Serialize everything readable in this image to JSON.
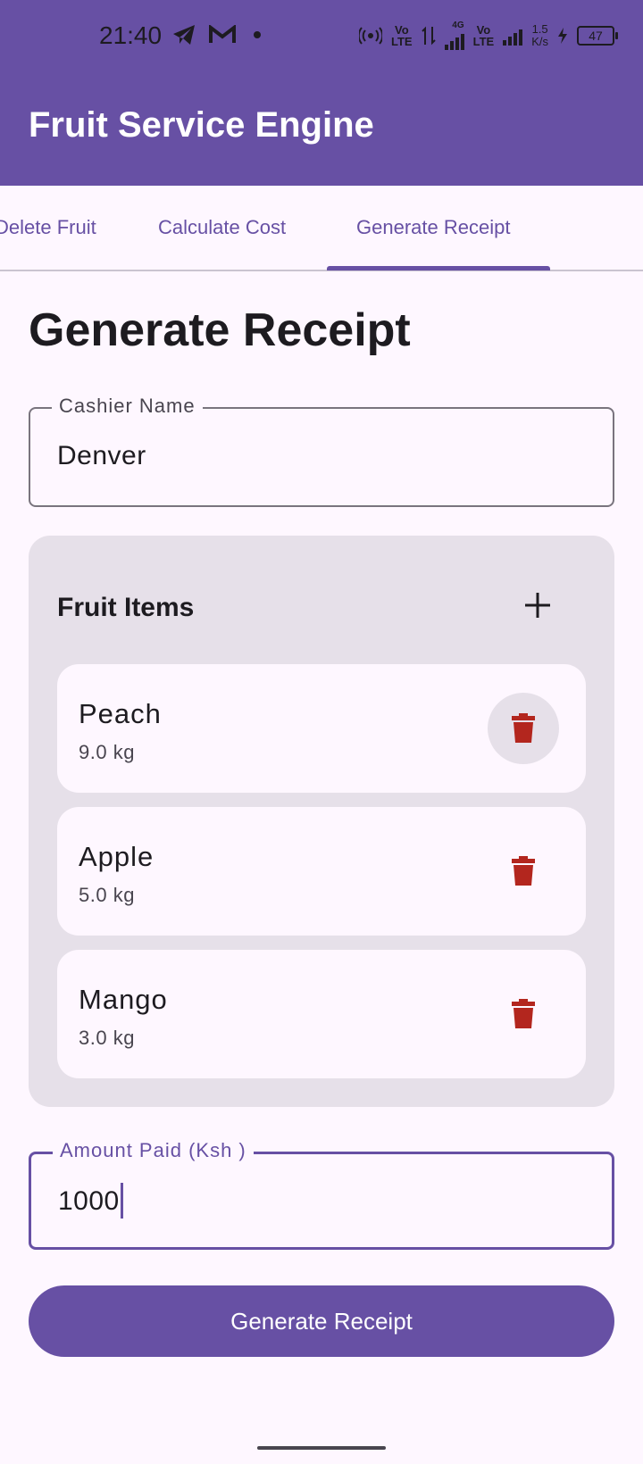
{
  "status_bar": {
    "time": "21:40",
    "network_label": "4G",
    "volte_label": "Vo\nLTE",
    "speed_value": "1.5",
    "speed_unit": "K/s",
    "battery": "47",
    "icons": [
      "telegram-icon",
      "gmail-icon",
      "dot-icon",
      "hotspot-icon",
      "data-arrows-icon",
      "signal-icon",
      "charging-icon"
    ]
  },
  "app_bar": {
    "title": "Fruit Service Engine"
  },
  "tabs": [
    {
      "label": "Delete Fruit",
      "selected": false
    },
    {
      "label": "Calculate Cost",
      "selected": false
    },
    {
      "label": "Generate Receipt",
      "selected": true
    }
  ],
  "page": {
    "heading": "Generate Receipt"
  },
  "cashier_field": {
    "label": "Cashier Name",
    "value": "Denver"
  },
  "fruit_items": {
    "title": "Fruit Items",
    "add_icon": "plus-icon",
    "delete_icon": "trash-icon",
    "items": [
      {
        "name": "Peach",
        "quantity": "9.0 kg"
      },
      {
        "name": "Apple",
        "quantity": "5.0 kg"
      },
      {
        "name": "Mango",
        "quantity": "3.0 kg"
      }
    ]
  },
  "amount_field": {
    "label": "Amount Paid (Ksh )",
    "value": "1000"
  },
  "submit_button": {
    "label": "Generate Receipt"
  },
  "colors": {
    "primary": "#6750a4",
    "background": "#fef7ff",
    "surface_variant": "#e6e0e9",
    "delete_red": "#b3261e"
  }
}
